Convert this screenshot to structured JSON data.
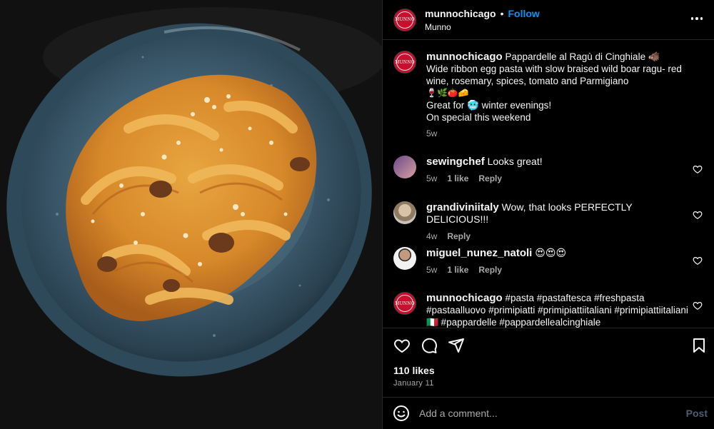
{
  "post": {
    "author": "munnochicago",
    "follow_label": "Follow",
    "separator": "•",
    "location": "Munno",
    "avatar_text": "MUNNO"
  },
  "caption": {
    "username": "munnochicago",
    "lines": [
      "Pappardelle al Ragù di Cinghiale 🐗",
      "Wide ribbon egg pasta with slow braised wild boar ragu- red wine, rosemary, spices, tomato and Parmigiano",
      "🍷🌿🍅🧀",
      "Great for 🥶 winter evenings!",
      "On special this weekend"
    ],
    "time": "5w"
  },
  "comments": [
    {
      "username": "sewingchef",
      "text": "Looks great!",
      "time": "5w",
      "likes": "1 like",
      "reply": "Reply",
      "avatar": "sewingchef-avatar"
    },
    {
      "username": "grandiviniitaly",
      "text": "Wow, that looks PERFECTLY DELICIOUS!!!",
      "time": "4w",
      "likes": "",
      "reply": "Reply",
      "avatar": "grandiviniitaly-avatar"
    },
    {
      "username": "miguel_nunez_natoli",
      "text": "😍😍😍",
      "time": "5w",
      "likes": "1 like",
      "reply": "Reply",
      "avatar": "miguel-avatar"
    },
    {
      "username": "munnochicago",
      "text": "#pasta #pastaftesca #freshpasta #pastaalluovo #primipiatti #primipiattiitaliani #primipiattiitaliani🇮🇹 #pappardelle #pappardellealcinghiale",
      "time": "",
      "likes": "",
      "reply": "",
      "avatar": "munno-avatar"
    }
  ],
  "actions": {
    "icons": [
      "heart-icon",
      "comment-icon",
      "share-icon",
      "bookmark-icon"
    ],
    "likes": "110 likes",
    "date": "January 11"
  },
  "add_comment": {
    "placeholder": "Add a comment...",
    "post_label": "Post"
  },
  "colors": {
    "accent": "#0095f6",
    "brand": "#c8102e",
    "muted": "#a8a8a8",
    "post_disabled": "#4a5d73"
  }
}
